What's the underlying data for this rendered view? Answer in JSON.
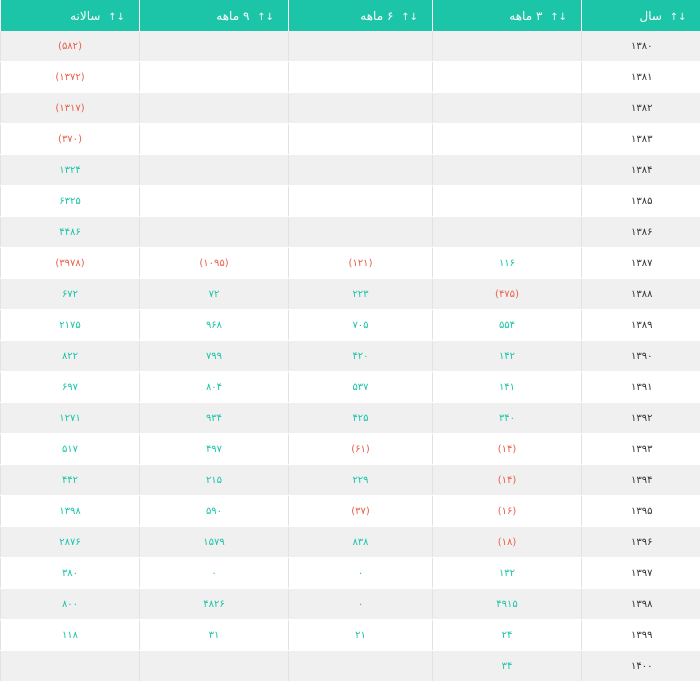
{
  "header": {
    "year": "سال",
    "m3": "۳ ماهه",
    "m6": "۶ ماهه",
    "m9": "۹ ماهه",
    "annual": "سالانه",
    "sort_icon_year": "↓↑",
    "sort_icon": "↓↑"
  },
  "rows": [
    {
      "year": "۱۳۸۰",
      "m3": "",
      "m6": "",
      "m9": "",
      "annual": "(۵۸۲)"
    },
    {
      "year": "۱۳۸۱",
      "m3": "",
      "m6": "",
      "m9": "",
      "annual": "(۱۳۷۲)"
    },
    {
      "year": "۱۳۸۲",
      "m3": "",
      "m6": "",
      "m9": "",
      "annual": "(۱۳۱۷)"
    },
    {
      "year": "۱۳۸۳",
      "m3": "",
      "m6": "",
      "m9": "",
      "annual": "(۳۷۰)"
    },
    {
      "year": "۱۳۸۴",
      "m3": "",
      "m6": "",
      "m9": "",
      "annual": "۱۳۲۴"
    },
    {
      "year": "۱۳۸۵",
      "m3": "",
      "m6": "",
      "m9": "",
      "annual": "۶۳۲۵"
    },
    {
      "year": "۱۳۸۶",
      "m3": "",
      "m6": "",
      "m9": "",
      "annual": "۴۴۸۶"
    },
    {
      "year": "۱۳۸۷",
      "m3": "۱۱۶",
      "m6": "(۱۲۱)",
      "m9": "(۱۰۹۵)",
      "annual": "(۳۹۷۸)"
    },
    {
      "year": "۱۳۸۸",
      "m3": "(۴۷۵)",
      "m6": "۲۲۳",
      "m9": "۷۲",
      "annual": "۶۷۲"
    },
    {
      "year": "۱۳۸۹",
      "m3": "۵۵۴",
      "m6": "۷۰۵",
      "m9": "۹۶۸",
      "annual": "۲۱۷۵"
    },
    {
      "year": "۱۳۹۰",
      "m3": "۱۴۲",
      "m6": "۴۲۰",
      "m9": "۷۹۹",
      "annual": "۸۲۲"
    },
    {
      "year": "۱۳۹۱",
      "m3": "۱۴۱",
      "m6": "۵۳۷",
      "m9": "۸۰۴",
      "annual": "۶۹۷"
    },
    {
      "year": "۱۳۹۲",
      "m3": "۳۴۰",
      "m6": "۴۲۵",
      "m9": "۹۳۴",
      "annual": "۱۲۷۱"
    },
    {
      "year": "۱۳۹۳",
      "m3": "(۱۴)",
      "m6": "(۶۱)",
      "m9": "۴۹۷",
      "annual": "۵۱۷"
    },
    {
      "year": "۱۳۹۴",
      "m3": "(۱۴)",
      "m6": "۲۲۹",
      "m9": "۲۱۵",
      "annual": "۴۴۲"
    },
    {
      "year": "۱۳۹۵",
      "m3": "(۱۶)",
      "m6": "(۳۷)",
      "m9": "۵۹۰",
      "annual": "۱۳۹۸"
    },
    {
      "year": "۱۳۹۶",
      "m3": "(۱۸)",
      "m6": "۸۳۸",
      "m9": "۱۵۷۹",
      "annual": "۲۸۷۶"
    },
    {
      "year": "۱۳۹۷",
      "m3": "۱۳۲",
      "m6": "۰",
      "m9": "۰",
      "annual": "۳۸۰"
    },
    {
      "year": "۱۳۹۸",
      "m3": "۴۹۱۵",
      "m6": "۰",
      "m9": "۴۸۲۶",
      "annual": "۸۰۰"
    },
    {
      "year": "۱۳۹۹",
      "m3": "۲۴",
      "m6": "۲۱",
      "m9": "۳۱",
      "annual": "۱۱۸"
    },
    {
      "year": "۱۴۰۰",
      "m3": "۳۴",
      "m6": "",
      "m9": "",
      "annual": ""
    }
  ],
  "colors": {
    "header_bg": "#1cc4a8",
    "positive": "#1cc4a8",
    "negative": "#e8604c",
    "stripe": "#f0f0f0"
  }
}
